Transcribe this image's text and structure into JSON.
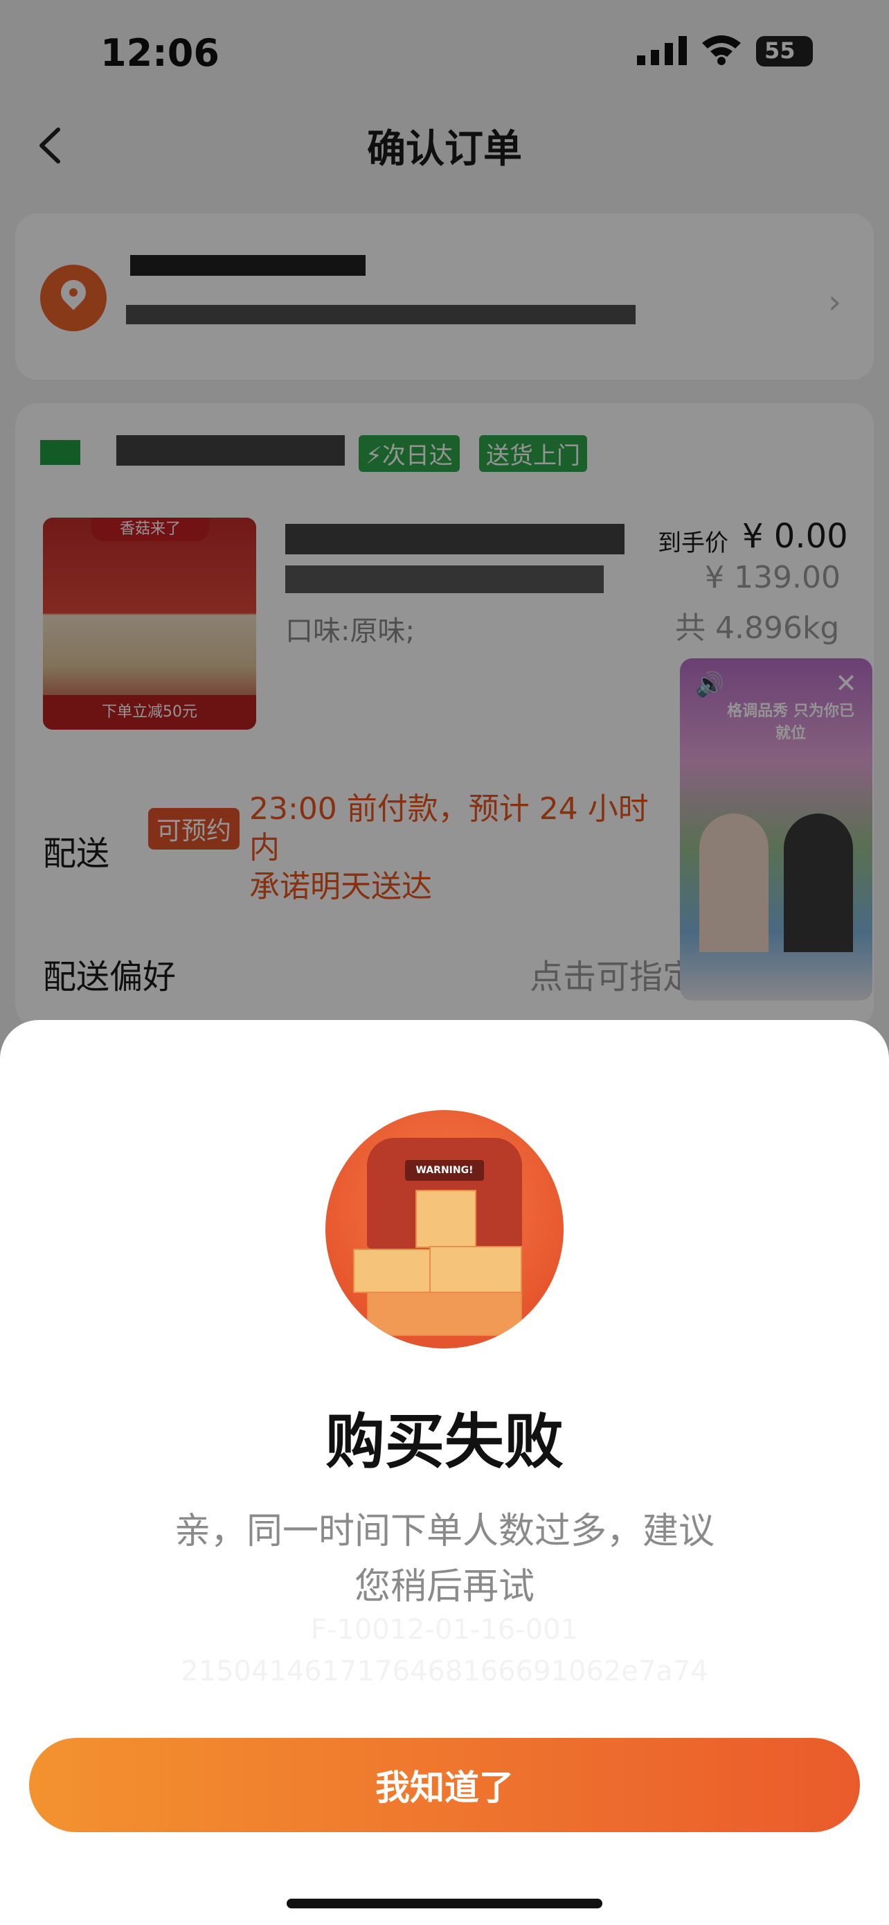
{
  "status_bar": {
    "time": "12:06",
    "battery": "55"
  },
  "nav": {
    "title": "确认订单"
  },
  "order": {
    "tags": [
      "次日达",
      "送货上门"
    ],
    "product": {
      "image_banner": "香菇来了",
      "image_footer": "下单立减50元",
      "price_label": "到手价",
      "price_now": "¥ 0.00",
      "price_original": "¥ 139.00",
      "flavor": "口味:原味;",
      "weight": "共 4.896kg"
    },
    "delivery": {
      "label": "配送",
      "badge": "可预约",
      "note_line1": "23:00 前付款，预计 24 小时内",
      "note_line2": "承诺明天送达"
    },
    "preference": {
      "label": "配送偏好",
      "hint": "点击可指定"
    }
  },
  "live_video": {
    "title": "格调品秀 只为你已就位"
  },
  "sheet": {
    "title": "购买失败",
    "message_line1": "亲，同一时间下单人数过多，建议",
    "message_line2": "您稍后再试",
    "code_line1": "F-10012-01-16-001",
    "code_line2": "2150414617176468166691062e7a74",
    "confirm_button": "我知道了"
  },
  "colors": {
    "accent": "#ea5b2c",
    "accent_start": "#f3922f",
    "green_tag": "#2fa64b"
  }
}
